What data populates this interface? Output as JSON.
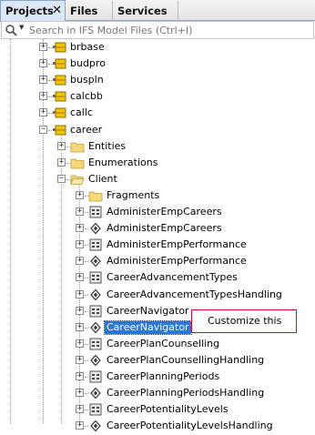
{
  "tabs": [
    {
      "label": "Projects",
      "close": "✕"
    },
    {
      "label": "Files"
    },
    {
      "label": "Services"
    }
  ],
  "search": {
    "placeholder": "Search in IFS Model Files (Ctrl+I)",
    "value": ""
  },
  "tree": {
    "rows": [
      {
        "label": "brbase",
        "icon": "package-icon",
        "toggle": "+",
        "level": 0
      },
      {
        "label": "budpro",
        "icon": "package-icon",
        "toggle": "+",
        "level": 0
      },
      {
        "label": "buspln",
        "icon": "package-icon",
        "toggle": "+",
        "level": 0
      },
      {
        "label": "calcbb",
        "icon": "package-icon",
        "toggle": "+",
        "level": 0
      },
      {
        "label": "callc",
        "icon": "package-icon",
        "toggle": "+",
        "level": 0
      },
      {
        "label": "career",
        "icon": "package-icon",
        "toggle": "−",
        "level": 0
      },
      {
        "label": "Entities",
        "icon": "folder-icon",
        "toggle": "+",
        "level": 1
      },
      {
        "label": "Enumerations",
        "icon": "folder-icon",
        "toggle": "+",
        "level": 1
      },
      {
        "label": "Client",
        "icon": "folder-open-icon",
        "toggle": "−",
        "level": 1
      },
      {
        "label": "Fragments",
        "icon": "folder-icon",
        "toggle": "+",
        "level": 2
      },
      {
        "label": "AdministerEmpCareers",
        "icon": "client-file-icon",
        "toggle": "+",
        "level": 2
      },
      {
        "label": "AdministerEmpCareers",
        "icon": "projection-file-icon",
        "toggle": "+",
        "level": 2
      },
      {
        "label": "AdministerEmpPerformance",
        "icon": "client-file-icon",
        "toggle": "+",
        "level": 2
      },
      {
        "label": "AdministerEmpPerformance",
        "icon": "projection-file-icon",
        "toggle": "+",
        "level": 2
      },
      {
        "label": "CareerAdvancementTypes",
        "icon": "client-file-icon",
        "toggle": "+",
        "level": 2
      },
      {
        "label": "CareerAdvancementTypesHandling",
        "icon": "projection-file-icon",
        "toggle": "+",
        "level": 2
      },
      {
        "label": "CareerNavigator",
        "icon": "client-file-icon",
        "toggle": "+",
        "level": 2
      },
      {
        "label": "CareerNavigator",
        "icon": "projection-file-icon",
        "toggle": "+",
        "level": 2,
        "selected": true
      },
      {
        "label": "CareerPlanCounselling",
        "icon": "client-file-icon",
        "toggle": "+",
        "level": 2
      },
      {
        "label": "CareerPlanCounsellingHandling",
        "icon": "projection-file-icon",
        "toggle": "+",
        "level": 2
      },
      {
        "label": "CareerPlanningPeriods",
        "icon": "client-file-icon",
        "toggle": "+",
        "level": 2
      },
      {
        "label": "CareerPlanningPeriodsHandling",
        "icon": "projection-file-icon",
        "toggle": "+",
        "level": 2
      },
      {
        "label": "CareerPotentialityLevels",
        "icon": "client-file-icon",
        "toggle": "+",
        "level": 2
      },
      {
        "label": "CareerPotentialityLevelsHandling",
        "icon": "projection-file-icon",
        "toggle": "+",
        "level": 2
      }
    ]
  },
  "callout": {
    "text": "Customize this",
    "border_color": "#c8102e"
  },
  "colors": {
    "selection": "#2b78d4",
    "package": "#e9b400",
    "folder": "#f3d46e"
  }
}
